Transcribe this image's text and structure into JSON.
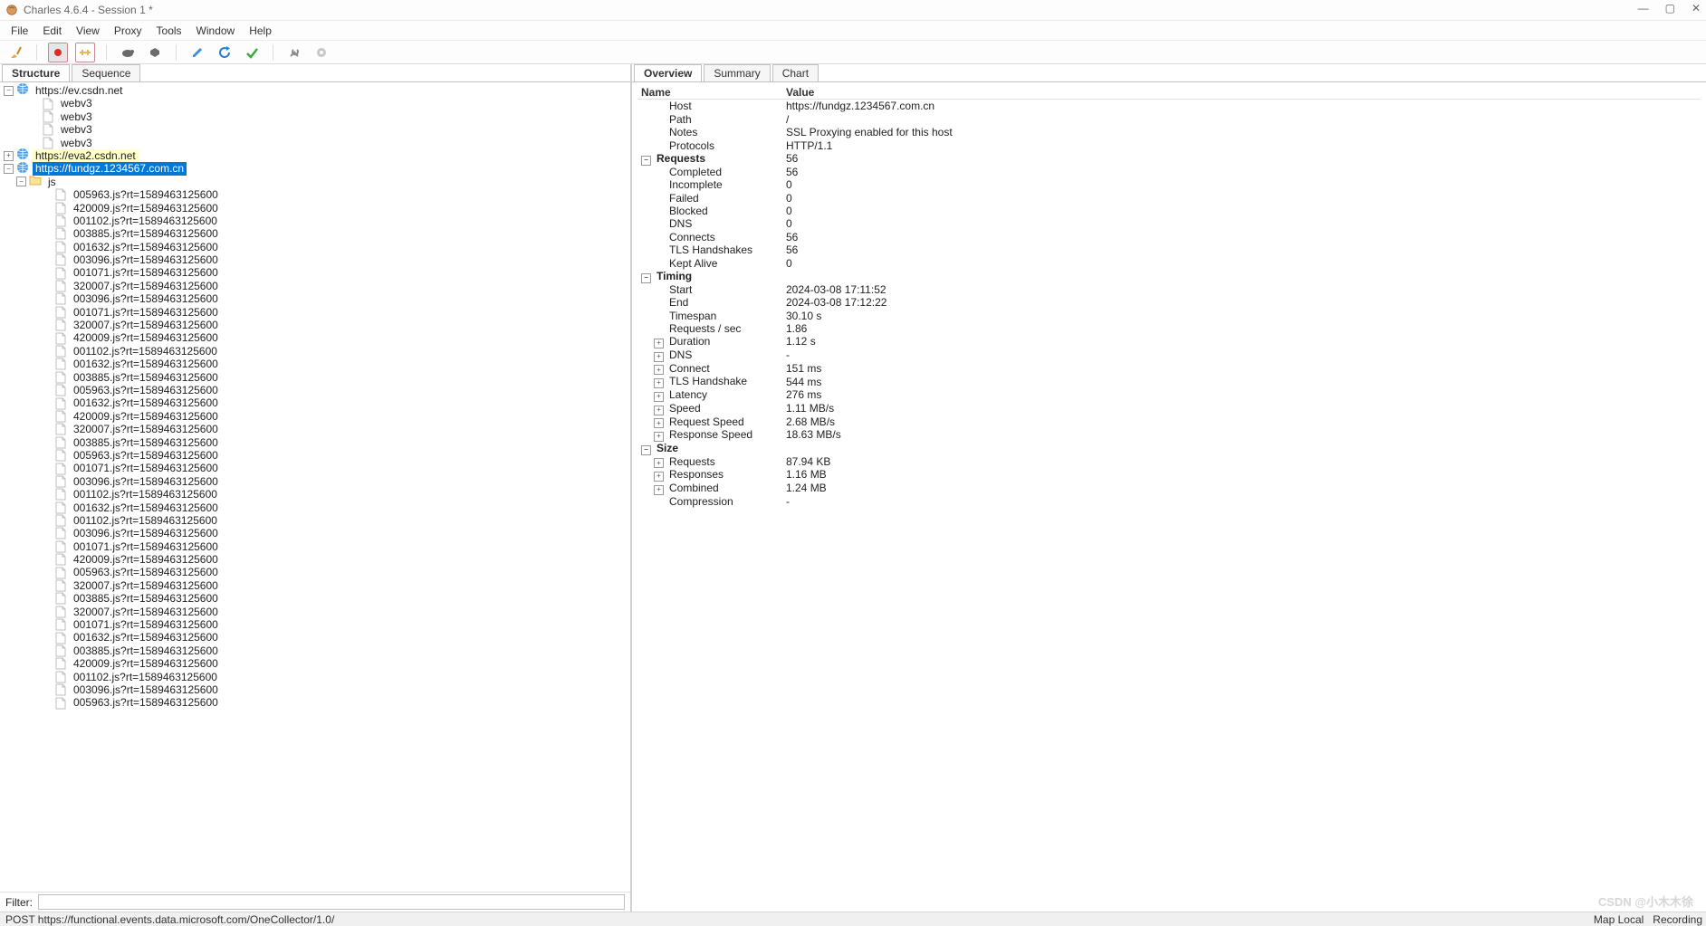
{
  "window": {
    "title": "Charles 4.6.4 - Session 1 *",
    "minimize": "—",
    "maximize": "▢",
    "close": "✕"
  },
  "menu": [
    "File",
    "Edit",
    "View",
    "Proxy",
    "Tools",
    "Window",
    "Help"
  ],
  "leftTabs": [
    "Structure",
    "Sequence"
  ],
  "rightTabs": [
    "Overview",
    "Summary",
    "Chart"
  ],
  "filter": {
    "label": "Filter:",
    "value": ""
  },
  "tree": {
    "hosts": [
      {
        "url": "https://ev.csdn.net",
        "expanded": true,
        "highlight": false,
        "children": [
          {
            "type": "file",
            "name": "webv3"
          },
          {
            "type": "file",
            "name": "webv3"
          },
          {
            "type": "file",
            "name": "webv3"
          },
          {
            "type": "file",
            "name": "webv3"
          }
        ]
      },
      {
        "url": "https://eva2.csdn.net",
        "expanded": false,
        "highlight": true,
        "children": []
      },
      {
        "url": "https://fundgz.1234567.com.cn",
        "expanded": true,
        "selected": true,
        "children": [
          {
            "type": "folder",
            "name": "js",
            "expanded": true,
            "children": [
              "005963.js?rt=1589463125600",
              "420009.js?rt=1589463125600",
              "001102.js?rt=1589463125600",
              "003885.js?rt=1589463125600",
              "001632.js?rt=1589463125600",
              "003096.js?rt=1589463125600",
              "001071.js?rt=1589463125600",
              "320007.js?rt=1589463125600",
              "003096.js?rt=1589463125600",
              "001071.js?rt=1589463125600",
              "320007.js?rt=1589463125600",
              "420009.js?rt=1589463125600",
              "001102.js?rt=1589463125600",
              "001632.js?rt=1589463125600",
              "003885.js?rt=1589463125600",
              "005963.js?rt=1589463125600",
              "001632.js?rt=1589463125600",
              "420009.js?rt=1589463125600",
              "320007.js?rt=1589463125600",
              "003885.js?rt=1589463125600",
              "005963.js?rt=1589463125600",
              "001071.js?rt=1589463125600",
              "003096.js?rt=1589463125600",
              "001102.js?rt=1589463125600",
              "001632.js?rt=1589463125600",
              "001102.js?rt=1589463125600",
              "003096.js?rt=1589463125600",
              "001071.js?rt=1589463125600",
              "420009.js?rt=1589463125600",
              "005963.js?rt=1589463125600",
              "320007.js?rt=1589463125600",
              "003885.js?rt=1589463125600",
              "320007.js?rt=1589463125600",
              "001071.js?rt=1589463125600",
              "001632.js?rt=1589463125600",
              "003885.js?rt=1589463125600",
              "420009.js?rt=1589463125600",
              "001102.js?rt=1589463125600",
              "003096.js?rt=1589463125600",
              "005963.js?rt=1589463125600"
            ]
          }
        ]
      }
    ]
  },
  "overview": {
    "headers": {
      "name": "Name",
      "value": "Value"
    },
    "top": [
      {
        "name": "Host",
        "value": "https://fundgz.1234567.com.cn"
      },
      {
        "name": "Path",
        "value": "/"
      },
      {
        "name": "Notes",
        "value": "SSL Proxying enabled for this host"
      },
      {
        "name": "Protocols",
        "value": "HTTP/1.1"
      }
    ],
    "groups": [
      {
        "label": "Requests",
        "value": "56",
        "toggle": "−",
        "rows": [
          {
            "name": "Completed",
            "value": "56"
          },
          {
            "name": "Incomplete",
            "value": "0"
          },
          {
            "name": "Failed",
            "value": "0"
          },
          {
            "name": "Blocked",
            "value": "0"
          },
          {
            "name": "DNS",
            "value": "0"
          },
          {
            "name": "Connects",
            "value": "56"
          },
          {
            "name": "TLS Handshakes",
            "value": "56"
          },
          {
            "name": "Kept Alive",
            "value": "0"
          }
        ]
      },
      {
        "label": "Timing",
        "value": "",
        "toggle": "−",
        "rows": [
          {
            "name": "Start",
            "value": "2024-03-08 17:11:52"
          },
          {
            "name": "End",
            "value": "2024-03-08 17:12:22"
          },
          {
            "name": "Timespan",
            "value": "30.10 s"
          },
          {
            "name": "Requests / sec",
            "value": "1.86"
          },
          {
            "name": "Duration",
            "value": "1.12 s",
            "toggle": "+"
          },
          {
            "name": "DNS",
            "value": "-",
            "toggle": "+"
          },
          {
            "name": "Connect",
            "value": "151 ms",
            "toggle": "+"
          },
          {
            "name": "TLS Handshake",
            "value": "544 ms",
            "toggle": "+"
          },
          {
            "name": "Latency",
            "value": "276 ms",
            "toggle": "+"
          },
          {
            "name": "Speed",
            "value": "1.11 MB/s",
            "toggle": "+"
          },
          {
            "name": "Request Speed",
            "value": "2.68 MB/s",
            "toggle": "+"
          },
          {
            "name": "Response Speed",
            "value": "18.63 MB/s",
            "toggle": "+"
          }
        ]
      },
      {
        "label": "Size",
        "value": "",
        "toggle": "−",
        "rows": [
          {
            "name": "Requests",
            "value": "87.94 KB",
            "toggle": "+"
          },
          {
            "name": "Responses",
            "value": "1.16 MB",
            "toggle": "+"
          },
          {
            "name": "Combined",
            "value": "1.24 MB",
            "toggle": "+"
          },
          {
            "name": "Compression",
            "value": "-"
          }
        ]
      }
    ]
  },
  "status": {
    "left": "POST https://functional.events.data.microsoft.com/OneCollector/1.0/",
    "mapLocal": "Map Local",
    "recording": "Recording"
  },
  "watermark": "CSDN @小木木徐"
}
